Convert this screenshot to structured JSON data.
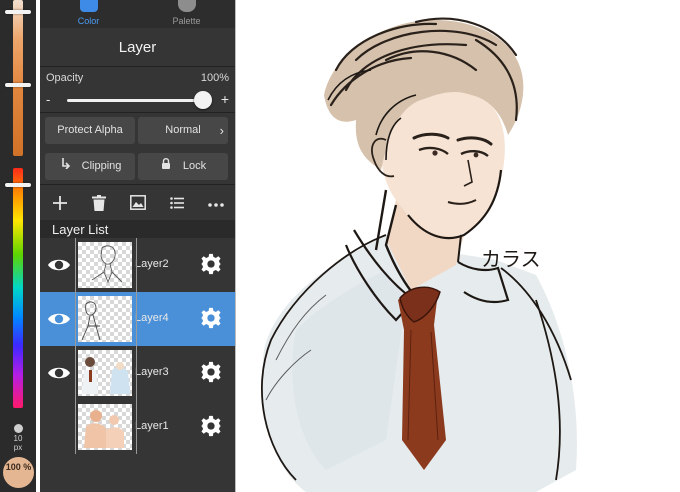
{
  "top_tabs": {
    "color": "Color",
    "palette": "Palette"
  },
  "panel_title": "Layer",
  "opacity": {
    "label": "Opacity",
    "value": "100%",
    "minus": "-",
    "plus": "+",
    "fraction": 1.0
  },
  "buttons": {
    "protect_alpha": "Protect Alpha",
    "blend_mode": "Normal",
    "clipping": "Clipping",
    "lock": "Lock"
  },
  "toolbar_icons": [
    "add-icon",
    "trash-icon",
    "image-icon",
    "list-icon",
    "more-icon"
  ],
  "layer_list_title": "Layer List",
  "layers": [
    {
      "name": "Layer2",
      "visible": true,
      "selected": false
    },
    {
      "name": "Layer4",
      "visible": true,
      "selected": true
    },
    {
      "name": "Layer3",
      "visible": true,
      "selected": false
    },
    {
      "name": "Layer1",
      "visible": false,
      "selected": false
    }
  ],
  "brush_size": {
    "value": "10",
    "unit": "px"
  },
  "zoom": "100 %",
  "canvas_text": "カラス",
  "colors": {
    "accent": "#4a90d8",
    "tie": "#8b3a1e",
    "current_color": "#e4b691"
  }
}
